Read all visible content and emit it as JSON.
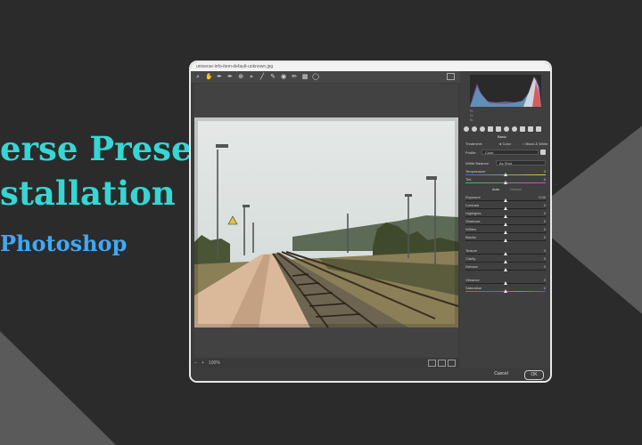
{
  "banner": {
    "line1": "erse Preset",
    "line2": "stallation",
    "line3": "Photoshop",
    "title_color": "#36d6d3",
    "sub_color": "#3fa9f5"
  },
  "dialog": {
    "title": "universe-info-item-default-unknown.jpg",
    "zoom": "100%",
    "cancel_label": "Cancel",
    "ok_label": "OK",
    "tools": [
      "zoom-icon",
      "hand-icon",
      "white-balance-icon",
      "color-sampler-icon",
      "targeted-adjust-icon",
      "crop-icon",
      "straighten-icon",
      "spot-removal-icon",
      "red-eye-icon",
      "brush-icon",
      "gradient-icon",
      "radial-icon"
    ],
    "panel": {
      "section": "Basic",
      "treatment_label": "Treatment:",
      "color_option": "Color",
      "bw_option": "Black & White",
      "profile_label": "Profile:",
      "profile_value": "Color",
      "wb_label": "White Balance:",
      "wb_value": "As Shot",
      "auto": "Auto",
      "default": "Default",
      "sliders": [
        {
          "label": "Temperature",
          "value": "0",
          "pos": 0.5
        },
        {
          "label": "Tint",
          "value": "0",
          "pos": 0.5
        },
        {
          "label": "Exposure",
          "value": "0.00",
          "pos": 0.5
        },
        {
          "label": "Contrast",
          "value": "0",
          "pos": 0.5
        },
        {
          "label": "Highlights",
          "value": "0",
          "pos": 0.5
        },
        {
          "label": "Shadows",
          "value": "0",
          "pos": 0.5
        },
        {
          "label": "Whites",
          "value": "0",
          "pos": 0.5
        },
        {
          "label": "Blacks",
          "value": "0",
          "pos": 0.5
        },
        {
          "label": "Texture",
          "value": "0",
          "pos": 0.5
        },
        {
          "label": "Clarity",
          "value": "0",
          "pos": 0.5
        },
        {
          "label": "Dehaze",
          "value": "0",
          "pos": 0.5
        },
        {
          "label": "Vibrance",
          "value": "0",
          "pos": 0.5
        },
        {
          "label": "Saturation",
          "value": "0",
          "pos": 0.5
        }
      ],
      "rgb": [
        "R:",
        "G:",
        "B:"
      ]
    }
  }
}
